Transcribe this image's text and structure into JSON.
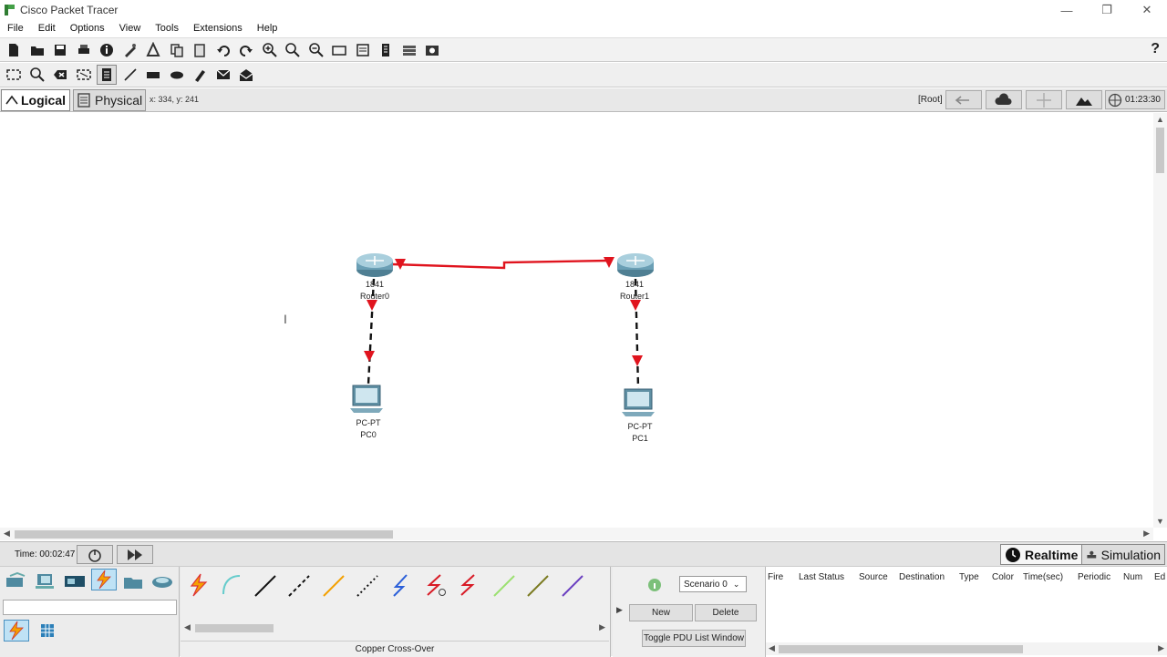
{
  "window": {
    "title": "Cisco Packet Tracer"
  },
  "menu": [
    "File",
    "Edit",
    "Options",
    "View",
    "Tools",
    "Extensions",
    "Help"
  ],
  "workspace": {
    "logical_label": "Logical",
    "physical_label": "Physical",
    "coords": "x: 334, y: 241",
    "root_label": "[Root]",
    "clock": "01:23:30"
  },
  "devices": [
    {
      "model": "1841",
      "name": "Router0",
      "type": "router"
    },
    {
      "model": "1841",
      "name": "Router1",
      "type": "router"
    },
    {
      "model": "PC-PT",
      "name": "PC0",
      "type": "pc"
    },
    {
      "model": "PC-PT",
      "name": "PC1",
      "type": "pc"
    }
  ],
  "links": [
    {
      "from": "Router0",
      "to": "Router1",
      "cable": "serial",
      "color": "#e0141e"
    },
    {
      "from": "Router0",
      "to": "PC0",
      "cable": "copper-crossover",
      "color": "#111111"
    },
    {
      "from": "Router1",
      "to": "PC1",
      "cable": "copper-crossover",
      "color": "#111111"
    }
  ],
  "bottom": {
    "time": "Time: 00:02:47",
    "realtime_label": "Realtime",
    "simulation_label": "Simulation",
    "connection_label": "Copper Cross-Over",
    "scenario": "Scenario 0",
    "new_label": "New",
    "delete_label": "Delete",
    "toggle_label": "Toggle PDU List Window",
    "pdu_columns": [
      "Fire",
      "Last Status",
      "Source",
      "Destination",
      "Type",
      "Color",
      "Time(sec)",
      "Periodic",
      "Num",
      "Ed"
    ]
  },
  "colors": {
    "link_down": "#e0141e",
    "accent": "#1a73c8"
  }
}
